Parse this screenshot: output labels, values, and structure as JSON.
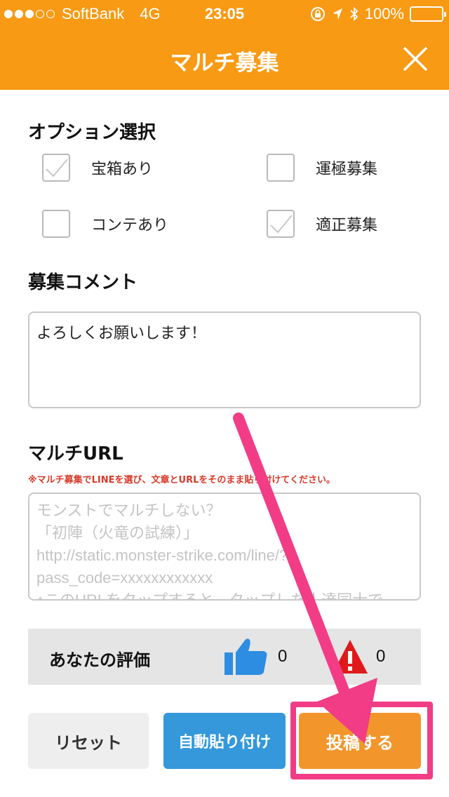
{
  "status_bar": {
    "carrier": "SoftBank",
    "network": "4G",
    "time": "23:05",
    "battery": "100%"
  },
  "nav": {
    "title": "マルチ募集"
  },
  "options": {
    "title": "オプション選択",
    "items": [
      {
        "label": "宝箱あり",
        "checked": true
      },
      {
        "label": "運極募集",
        "checked": false
      },
      {
        "label": "コンテあり",
        "checked": false
      },
      {
        "label": "適正募集",
        "checked": true
      }
    ]
  },
  "comment": {
    "title": "募集コメント",
    "value": "よろしくお願いします！"
  },
  "multi_url": {
    "title": "マルチURL",
    "note": "※マルチ募集でLINEを選び、文章とURLをそのまま貼り付けてください。",
    "placeholder": "モンストでマルチしない？\n「初陣（火竜の試練）」\nhttp://static.monster-strike.com/line/?\npass_code=xxxxxxxxxxxx\n↑このURLをタップすると、タップした人達同士で"
  },
  "rating": {
    "label": "あなたの評価",
    "good_count": "0",
    "bad_count": "0"
  },
  "buttons": {
    "reset": "リセット",
    "auto_paste": "自動貼り付け",
    "post": "投稿する"
  },
  "colors": {
    "header": "#f89a14",
    "highlight": "#f23c86",
    "thumb": "#2d8de0",
    "bad": "#e01a1a"
  }
}
